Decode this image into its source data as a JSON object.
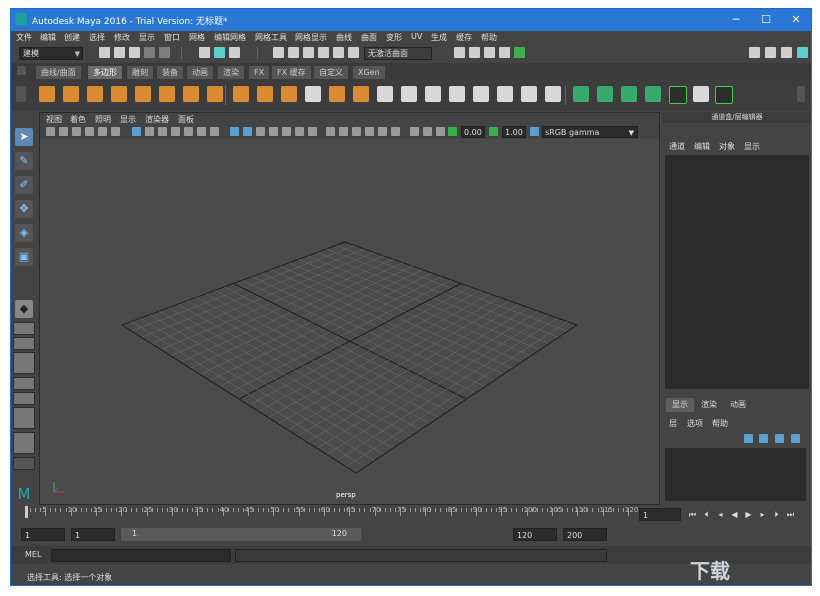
{
  "window": {
    "title": "Autodesk Maya 2016 - Trial Version: 无标题*",
    "minimize": "─",
    "maximize": "☐",
    "close": "✕"
  },
  "menubar": [
    "文件",
    "编辑",
    "创建",
    "选择",
    "修改",
    "显示",
    "窗口",
    "网格",
    "编辑网格",
    "网格工具",
    "网格显示",
    "曲线",
    "曲面",
    "变形",
    "UV",
    "生成",
    "缓存",
    "帮助"
  ],
  "status_line": {
    "mode": "建模",
    "live_surface": "无激活曲面"
  },
  "shelf_tabs": [
    "曲线/曲面",
    "多边形",
    "雕刻",
    "装备",
    "动画",
    "渲染",
    "FX",
    "FX 缓存",
    "自定义",
    "XGen"
  ],
  "active_shelf_tab": "多边形",
  "viewport": {
    "menus": [
      "视图",
      "着色",
      "照明",
      "显示",
      "渲染器",
      "面板"
    ],
    "gamma_value_1": "0.00",
    "gamma_value_2": "1.00",
    "color_space": "sRGB gamma",
    "camera_label": "persp"
  },
  "right_panel": {
    "title": "通道盒/层编辑器",
    "menus": [
      "通道",
      "编辑",
      "对象",
      "显示"
    ],
    "tabs": [
      "显示",
      "渲染",
      "动画"
    ],
    "active_tab": "显示",
    "layer_menus": [
      "层",
      "选项",
      "帮助"
    ]
  },
  "timeline": {
    "ticks": [
      "5",
      "10",
      "15",
      "20",
      "25",
      "30",
      "35",
      "40",
      "45",
      "50",
      "55",
      "60",
      "65",
      "70",
      "75",
      "80",
      "85",
      "90",
      "95",
      "100",
      "105",
      "110",
      "115",
      "120"
    ],
    "current_frame": "1"
  },
  "range": {
    "start": "1",
    "playback_start": "1",
    "slider_start": "1",
    "slider_end": "120",
    "playback_end": "120",
    "end": "200"
  },
  "command": {
    "label": "MEL"
  },
  "help_line": {
    "text": "选择工具: 选择一个对象"
  },
  "watermark": {
    "text": "下载"
  }
}
